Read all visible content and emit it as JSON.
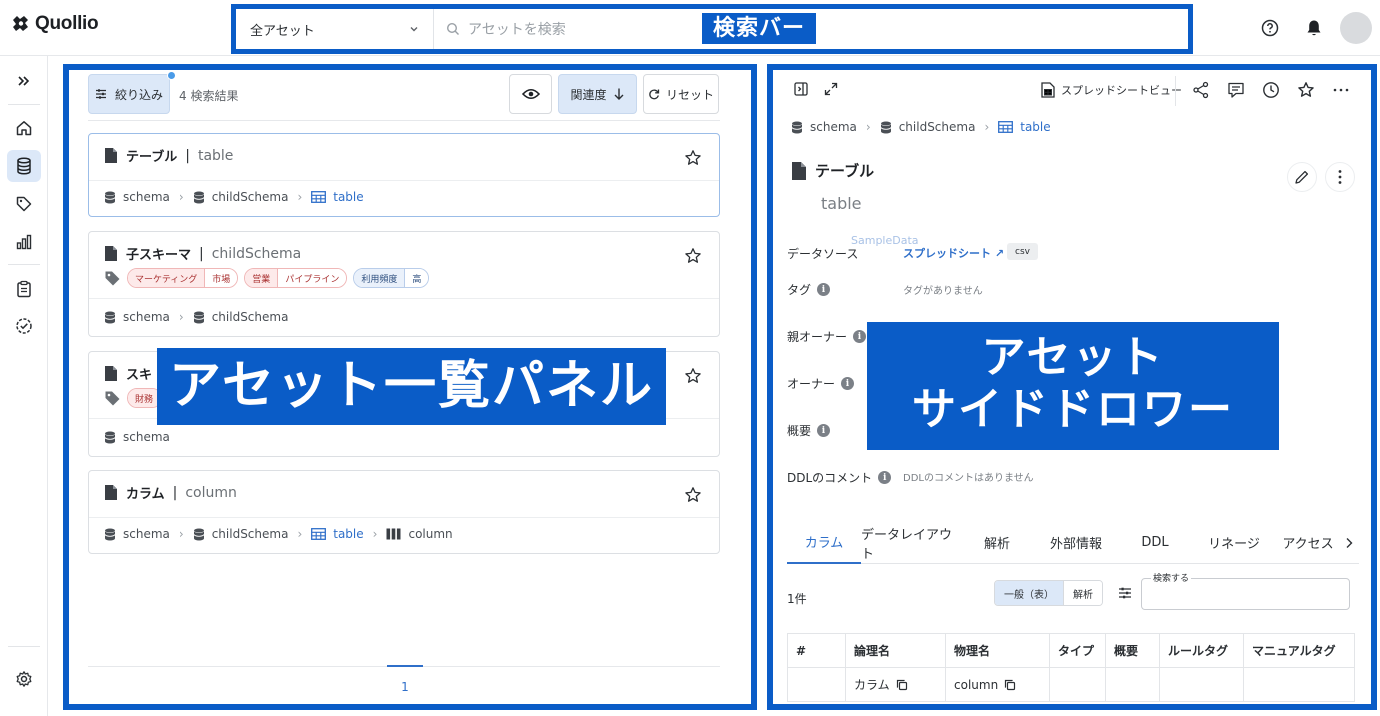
{
  "app": {
    "brand": "Quollio"
  },
  "header": {
    "scope_select": "全アセット",
    "search_placeholder": "アセットを検索",
    "annotation": "検索バー"
  },
  "rail": {
    "items": [
      {
        "name": "expand",
        "icon": "double-chevron-right-icon"
      },
      {
        "name": "home",
        "icon": "home-icon"
      },
      {
        "name": "assets",
        "icon": "database-icon",
        "active": true
      },
      {
        "name": "tags",
        "icon": "tag-icon"
      },
      {
        "name": "analytics",
        "icon": "bar-chart-icon"
      },
      {
        "name": "tasks",
        "icon": "clipboard-icon"
      },
      {
        "name": "quality",
        "icon": "check-circle-icon"
      },
      {
        "name": "settings",
        "icon": "gear-icon"
      }
    ]
  },
  "list": {
    "filter_label": "絞り込み",
    "result_count": "4 検索結果",
    "sort_label": "関連度",
    "reset_label": "リセット",
    "annotation": "アセット一覧パネル",
    "page": "1",
    "cards": [
      {
        "name": "テーブル",
        "physical": "table",
        "path": [
          "schema",
          "childSchema",
          "table"
        ]
      },
      {
        "name": "子スキーマ",
        "physical": "childSchema",
        "tags": [
          {
            "key": "マーケティング",
            "value": "市場",
            "color": "red"
          },
          {
            "key": "営業",
            "value": "パイプライン",
            "color": "red"
          },
          {
            "key": "利用頻度",
            "value": "高",
            "color": "blue"
          }
        ],
        "path": [
          "schema",
          "childSchema"
        ]
      },
      {
        "name": "スキ",
        "tag_partial": "財務",
        "path": [
          "schema"
        ]
      },
      {
        "name": "カラム",
        "physical": "column",
        "path": [
          "schema",
          "childSchema",
          "table",
          "column"
        ]
      }
    ]
  },
  "drawer": {
    "annotation_line1": "アセット",
    "annotation_line2": "サイドドロワー",
    "sheet_view": "スプレッドシートビュー",
    "breadcrumb": [
      "schema",
      "childSchema",
      "table"
    ],
    "title": "テーブル",
    "physical": "table",
    "props": {
      "datasource_label": "データソース",
      "datasource_sample": "SampleData",
      "datasource_link": "スプレッドシート ↗",
      "datasource_format": "csv",
      "tag_label": "タグ",
      "tag_empty": "タグがありません",
      "parent_owner_label": "親オーナー",
      "owner_label": "オーナー",
      "summary_label": "概要",
      "ddl_comment_label": "DDLのコメント",
      "ddl_comment_empty": "DDLのコメントはありません"
    },
    "tabs": [
      "カラム",
      "データレイアウト",
      "解析",
      "外部情報",
      "DDL",
      "リネージ",
      "アクセス"
    ],
    "count": "1件",
    "view_toggle": {
      "on": "一般（表）",
      "off": "解析"
    },
    "search_label": "検索する",
    "table": {
      "headers": [
        "#",
        "論理名",
        "物理名",
        "タイプ",
        "概要",
        "ルールタグ",
        "マニュアルタグ"
      ],
      "rows": [
        {
          "idx": "",
          "logical": "カラム",
          "physical": "column",
          "type": "",
          "summary": "",
          "rule_tag": "",
          "manual_tag": ""
        }
      ]
    }
  },
  "colors": {
    "annotation": "#0a5cc7",
    "accent": "#2f6fc9",
    "selected_bg": "#dce8f8"
  }
}
